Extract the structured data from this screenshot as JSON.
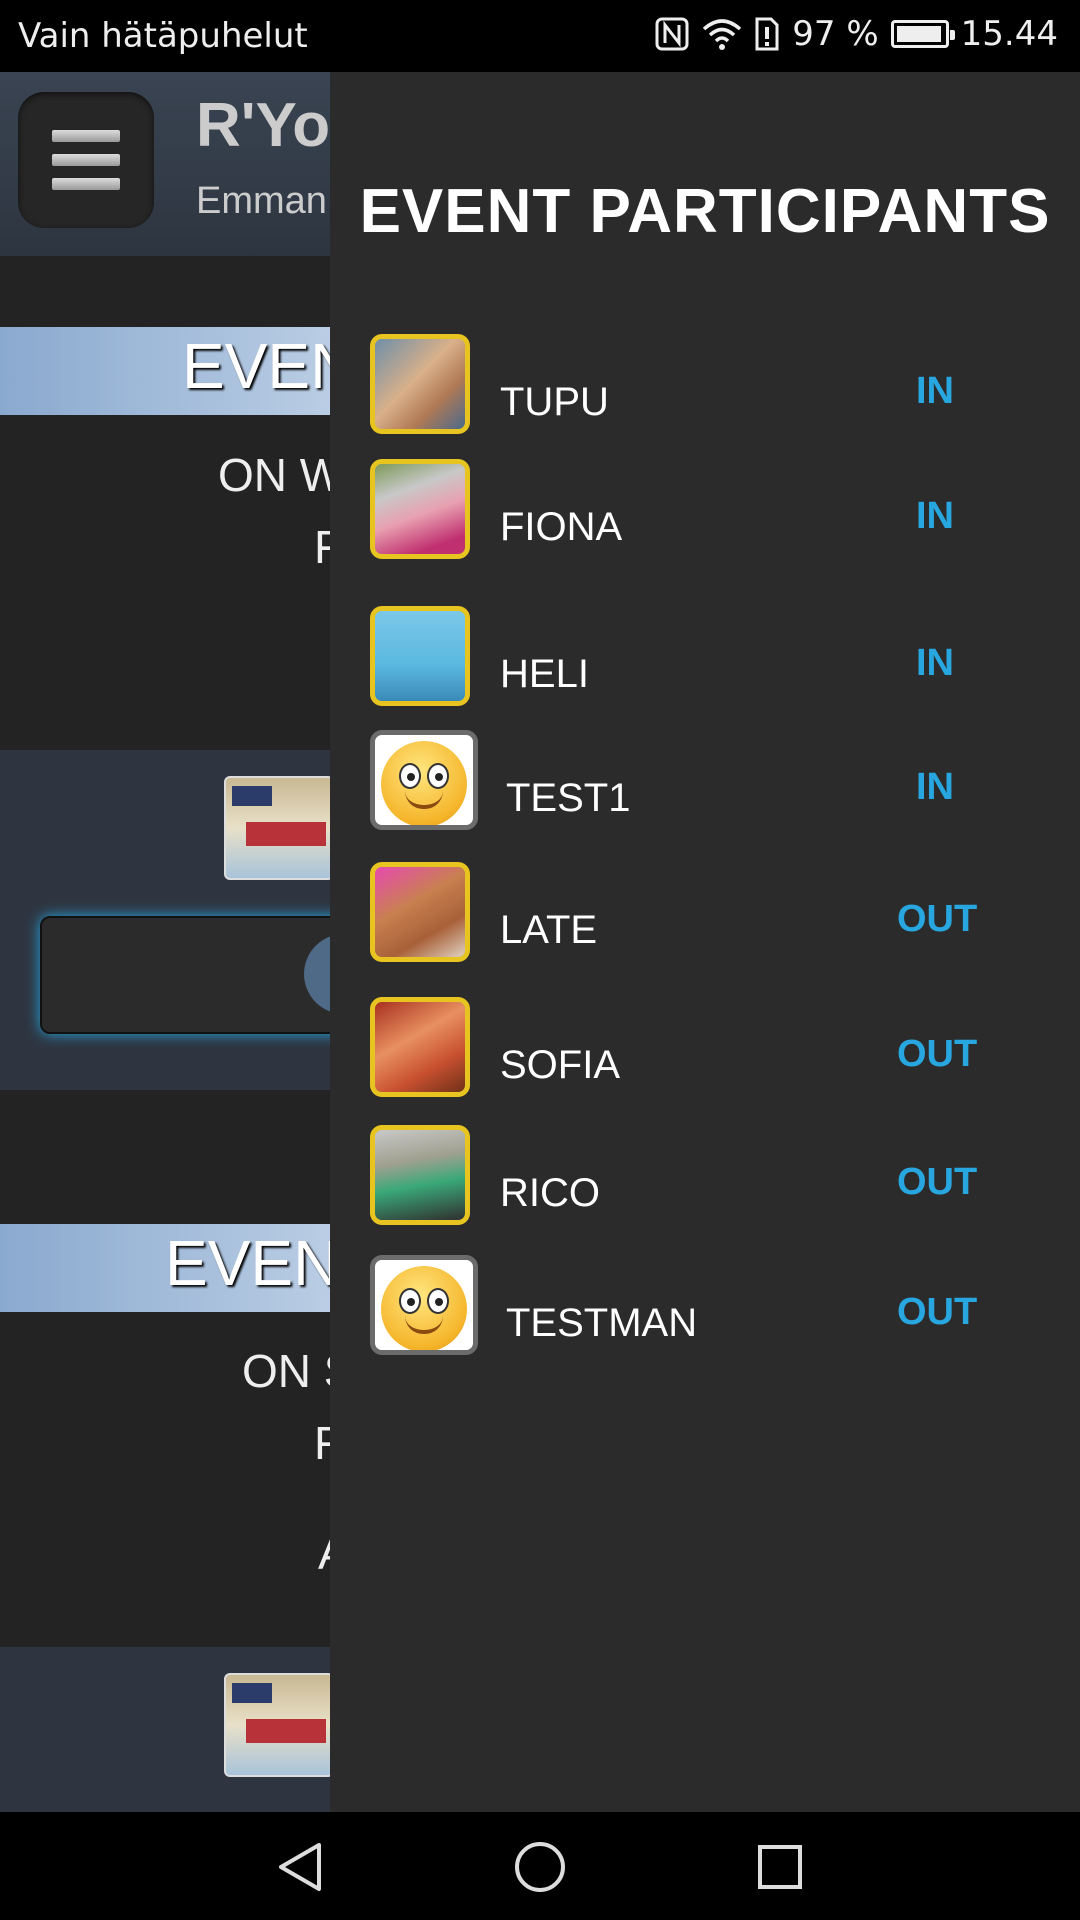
{
  "status_bar": {
    "carrier": "Vain hätäpuhelut",
    "battery_percent": "97 %",
    "battery_level": 0.97,
    "time": "15.44",
    "icons": [
      "nfc-icon",
      "wifi-icon",
      "sim-alert-icon",
      "battery-icon"
    ]
  },
  "app": {
    "title": "R'You",
    "subtitle": "Emman",
    "sections": [
      {
        "band_label": "EVEN",
        "line1": "ON W",
        "line2": "F"
      },
      {
        "band_label": "EVEN",
        "line1": "ON S",
        "line2": "F",
        "line3": "A"
      }
    ]
  },
  "drawer": {
    "title": "EVENT PARTICIPANTS",
    "participants": [
      {
        "name": "TUPU",
        "status": "IN",
        "avatar": "photo"
      },
      {
        "name": "FIONA",
        "status": "IN",
        "avatar": "photo"
      },
      {
        "name": "HELI",
        "status": "IN",
        "avatar": "photo"
      },
      {
        "name": "TEST1",
        "status": "IN",
        "avatar": "smiley"
      },
      {
        "name": "LATE",
        "status": "OUT",
        "avatar": "photo"
      },
      {
        "name": "SOFIA",
        "status": "OUT",
        "avatar": "photo"
      },
      {
        "name": "RICO",
        "status": "OUT",
        "avatar": "photo"
      },
      {
        "name": "TESTMAN",
        "status": "OUT",
        "avatar": "smiley"
      }
    ]
  },
  "colors": {
    "status_blue": "#27a6e0",
    "avatar_border_gold": "#e8c420",
    "avatar_border_gray": "#6b6b6b",
    "drawer_bg": "#2b2b2b"
  },
  "nav_bar": {
    "buttons": [
      "back-icon",
      "home-icon",
      "recents-icon"
    ]
  }
}
